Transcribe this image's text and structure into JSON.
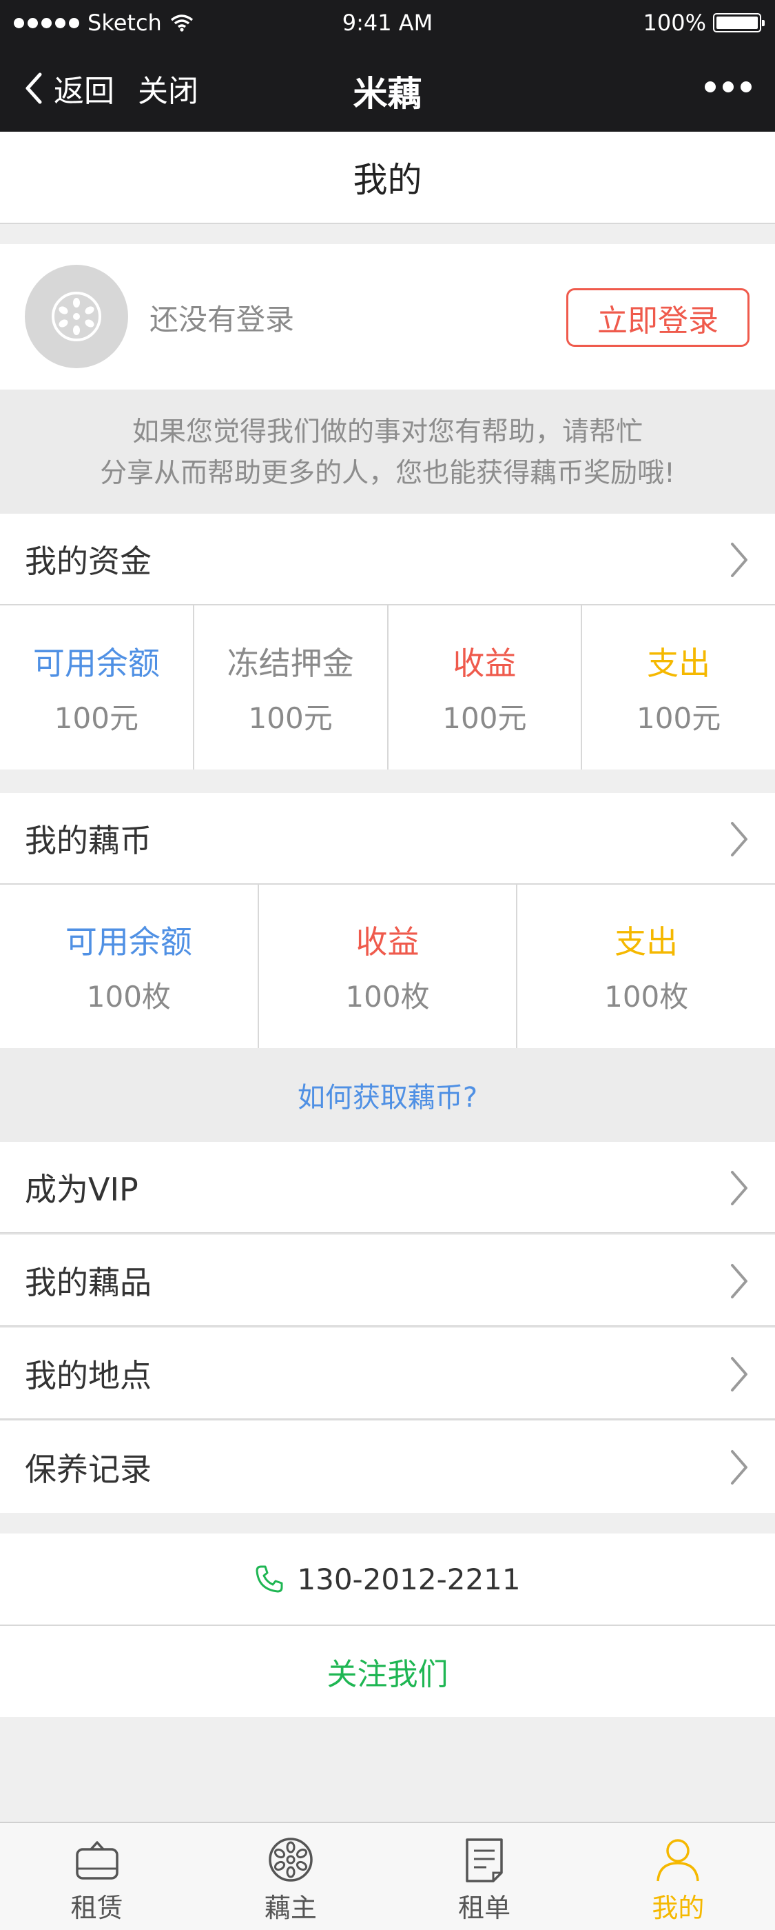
{
  "status_bar": {
    "carrier": "Sketch",
    "time": "9:41 AM",
    "battery": "100%"
  },
  "nav": {
    "back_label": "返回",
    "close_label": "关闭",
    "title": "米藕"
  },
  "page_title": "我的",
  "profile": {
    "not_logged_text": "还没有登录",
    "login_button": "立即登录"
  },
  "share_tip": {
    "line1": "如果您觉得我们做的事对您有帮助，请帮忙",
    "line2": "分享从而帮助更多的人，您也能获得藕币奖励哦!"
  },
  "funds": {
    "title": "我的资金",
    "items": [
      {
        "label": "可用余额",
        "value": "100元",
        "color": "#4f90e4"
      },
      {
        "label": "冻结押金",
        "value": "100元",
        "color": "#8a8a8a"
      },
      {
        "label": "收益",
        "value": "100元",
        "color": "#ef5a4c"
      },
      {
        "label": "支出",
        "value": "100元",
        "color": "#f5b800"
      }
    ]
  },
  "coins": {
    "title": "我的藕币",
    "items": [
      {
        "label": "可用余额",
        "value": "100枚",
        "color": "#4f90e4"
      },
      {
        "label": "收益",
        "value": "100枚",
        "color": "#ef5a4c"
      },
      {
        "label": "支出",
        "value": "100枚",
        "color": "#f5b800"
      }
    ],
    "how_to_link": "如何获取藕币?"
  },
  "menu": [
    {
      "label": "成为VIP"
    },
    {
      "label": "我的藕品"
    },
    {
      "label": "我的地点"
    },
    {
      "label": "保养记录"
    }
  ],
  "contact": {
    "phone": "130-2012-2211",
    "follow": "关注我们",
    "follow_color": "#1fb653",
    "phone_icon_color": "#1fb653"
  },
  "tabbar": {
    "active_color": "#f5b800",
    "items": [
      {
        "label": "租赁",
        "icon": "bag-icon"
      },
      {
        "label": "藕主",
        "icon": "lotus-root-icon"
      },
      {
        "label": "租单",
        "icon": "order-list-icon"
      },
      {
        "label": "我的",
        "icon": "user-icon",
        "active": true
      }
    ]
  },
  "colors": {
    "accent_red": "#ef5a4c",
    "accent_blue": "#4f90e4",
    "accent_yellow": "#f5b800",
    "nav_bg": "#1b1b1d"
  }
}
